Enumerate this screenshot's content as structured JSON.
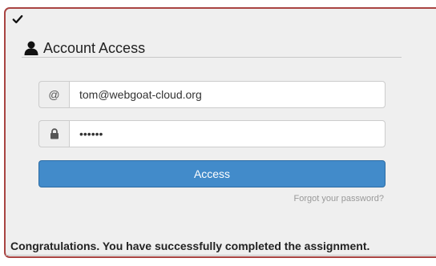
{
  "assignment": {
    "status_icon": "checkmark-icon",
    "legend": {
      "icon": "user-icon",
      "title": "Account Access"
    },
    "form": {
      "email": {
        "icon_text": "@",
        "value": "tom@webgoat-cloud.org"
      },
      "password": {
        "icon": "lock-icon",
        "value": "••••••"
      },
      "submit_label": "Access",
      "forgot_link": "Forgot your password?"
    },
    "feedback": "Congratulations. You have successfully completed the assignment."
  },
  "colors": {
    "panel_border": "#a94442",
    "panel_background": "#efefef",
    "button": "#428bca"
  }
}
